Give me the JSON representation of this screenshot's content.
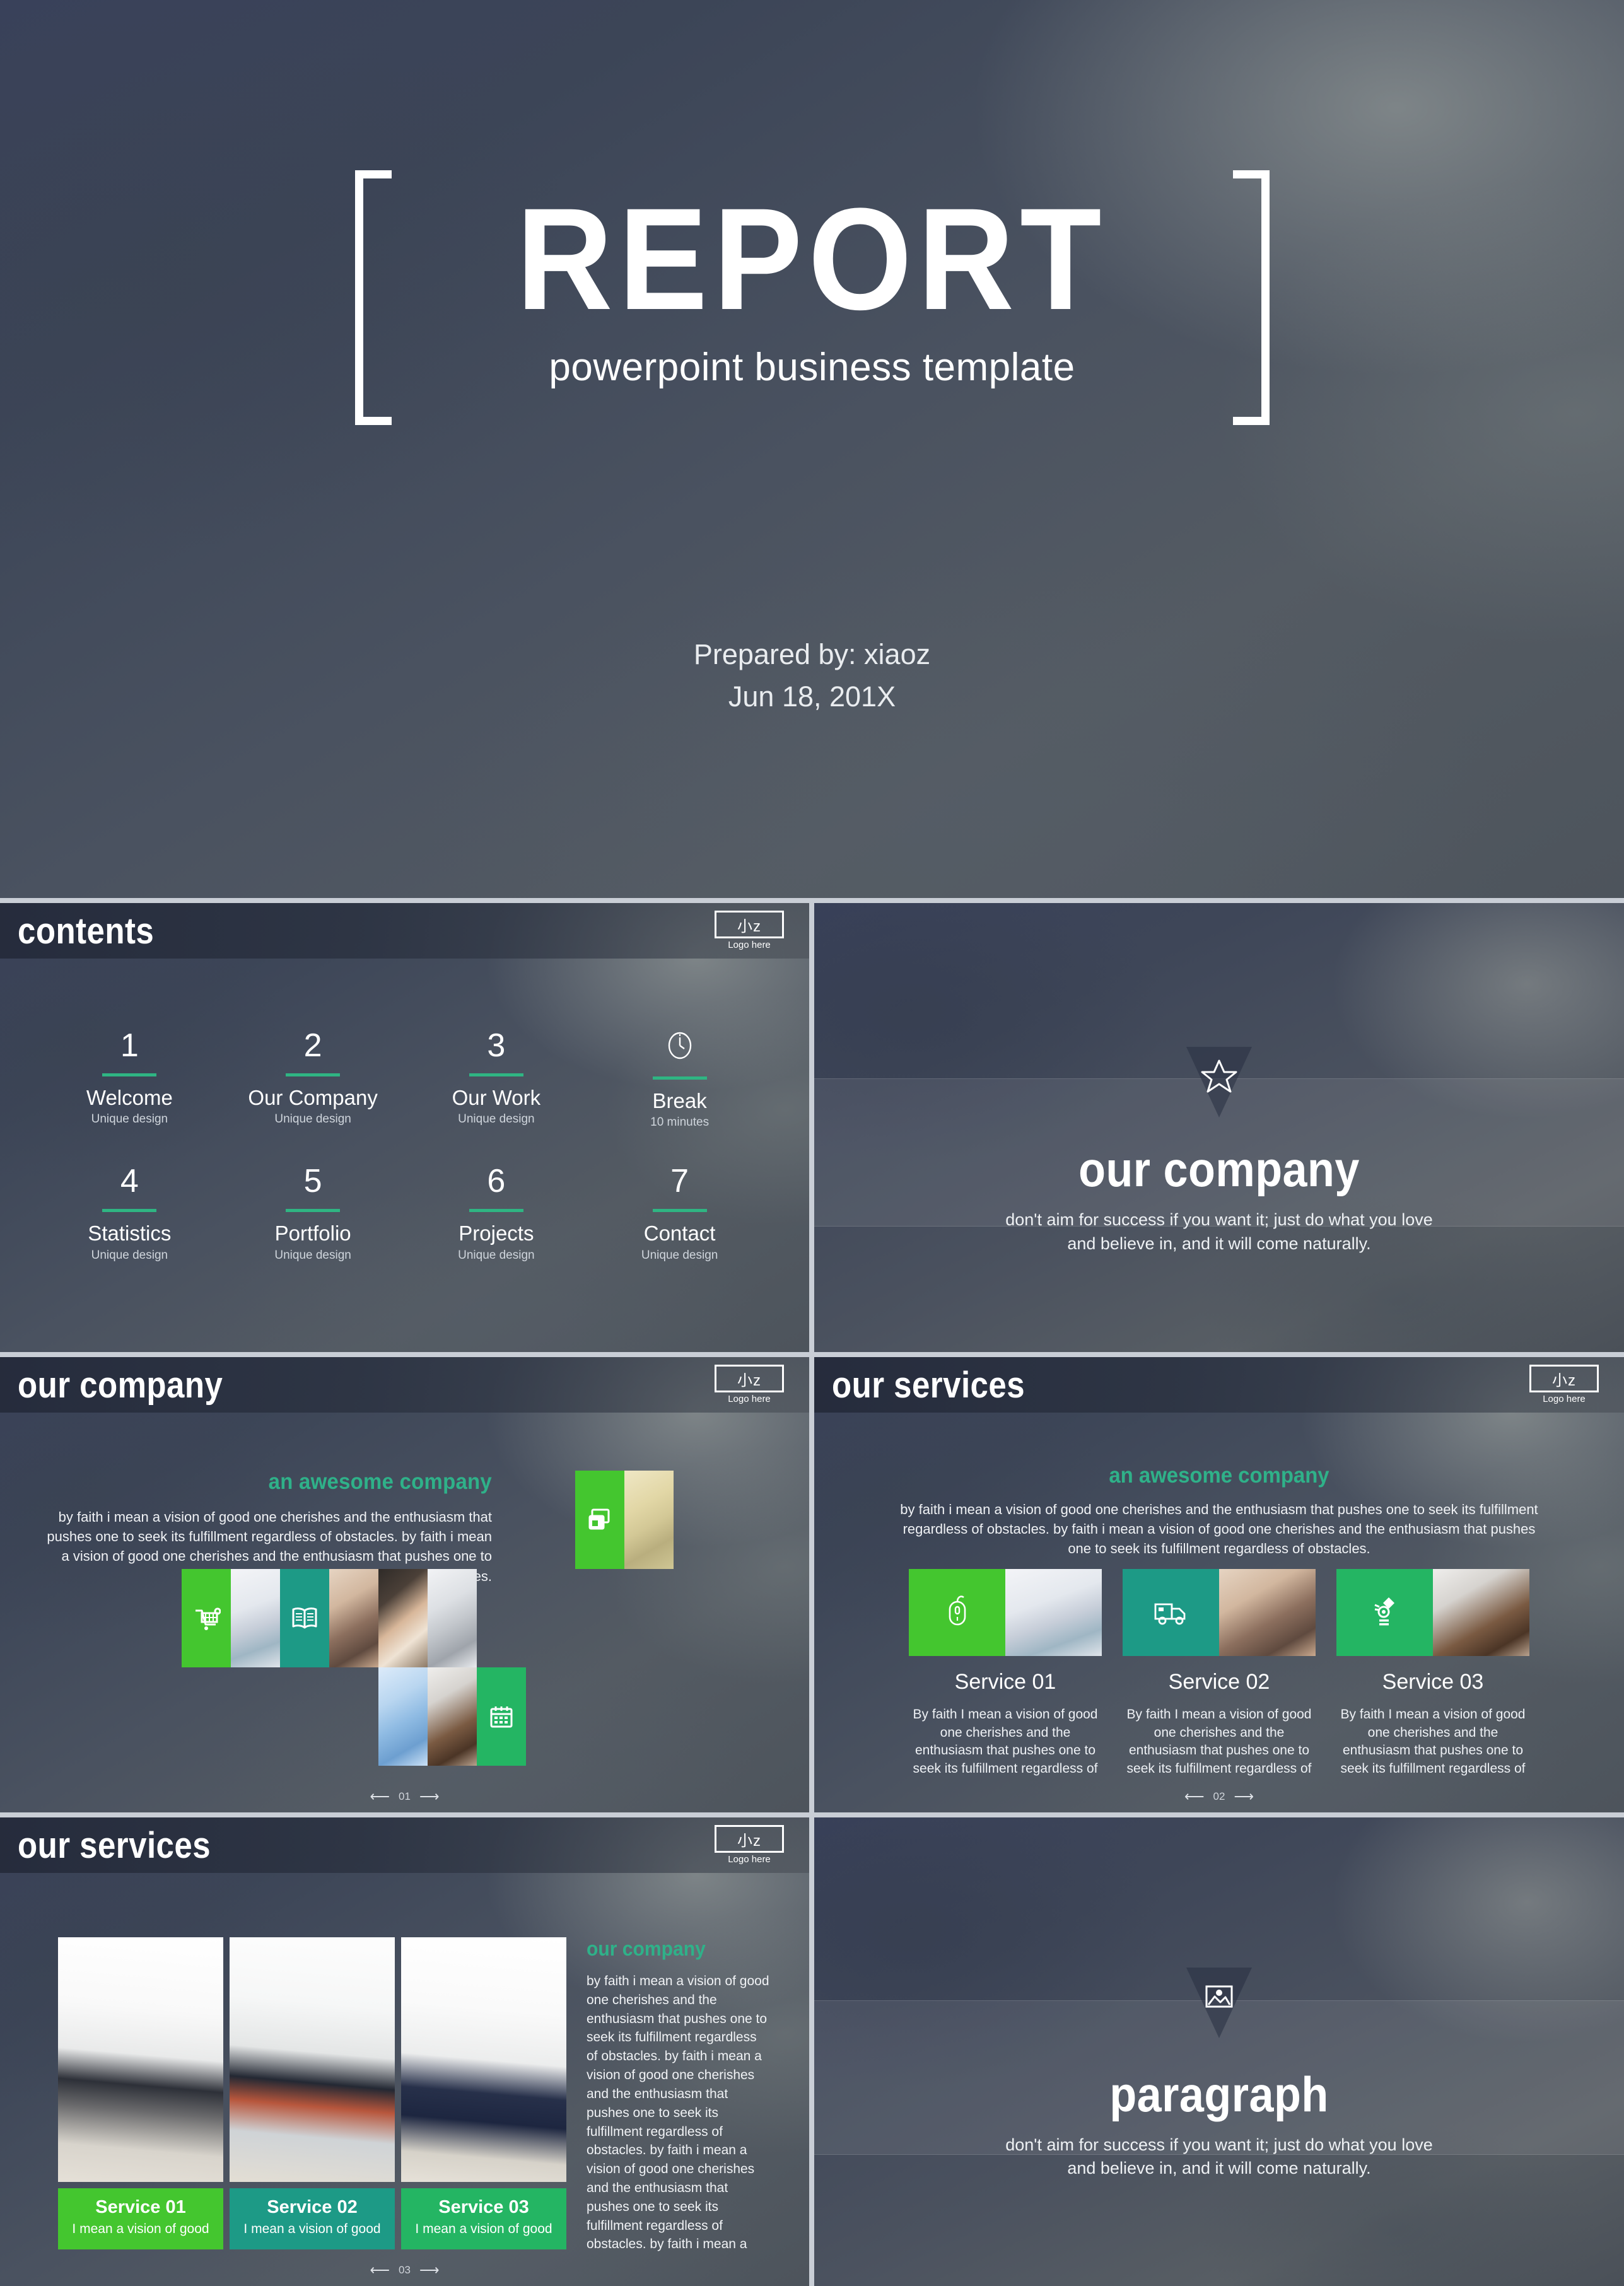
{
  "cover": {
    "title": "REPORT",
    "subtitle": "powerpoint business template",
    "prepared_by": "Prepared by: xiaoz",
    "date": "Jun 18, 201X"
  },
  "brand": {
    "logo_mark": "小z",
    "logo_caption": "Logo here",
    "accent_green": "#2fb189",
    "tile_green": "#44c62f",
    "tile_teal": "#1d9a86",
    "tile_emerald": "#24b563",
    "rule_green": "#2fb583"
  },
  "contents": {
    "header_title": "contents",
    "items": [
      {
        "num": "1",
        "label": "Welcome",
        "note": "Unique design",
        "icon": ""
      },
      {
        "num": "2",
        "label": "Our Company",
        "note": "Unique design",
        "icon": ""
      },
      {
        "num": "3",
        "label": "Our Work",
        "note": "Unique design",
        "icon": ""
      },
      {
        "num": "",
        "label": "Break",
        "note": "10 minutes",
        "icon": "clock-icon"
      },
      {
        "num": "4",
        "label": "Statistics",
        "note": "Unique design",
        "icon": ""
      },
      {
        "num": "5",
        "label": "Portfolio",
        "note": "Unique design",
        "icon": ""
      },
      {
        "num": "6",
        "label": "Projects",
        "note": "Unique design",
        "icon": ""
      },
      {
        "num": "7",
        "label": "Contact",
        "note": "Unique design",
        "icon": ""
      }
    ]
  },
  "section_company": {
    "icon": "star-icon",
    "title": "our company",
    "quote_line1": "don't aim for success if you want it; just do what you love",
    "quote_line2": "and believe in, and it will come naturally."
  },
  "section_paragraph": {
    "icon": "image-icon",
    "title": "paragraph",
    "quote_line1": "don't aim for success if you want it; just do what you love",
    "quote_line2": "and believe in, and it will come naturally."
  },
  "company": {
    "header_title": "our company",
    "heading": "an awesome company",
    "body": "by faith i mean a vision of good one cherishes and the enthusiasm that pushes one to seek its fulfillment regardless of obstacles. by faith i mean a vision of good one cherishes and the enthusiasm that pushes one to seek its fulfillment regardless of obstacles.",
    "page": "01",
    "prev_arrow": "⟵",
    "next_arrow": "⟶",
    "tiles": [
      {
        "kind": "icon",
        "icon": "cards-icon",
        "color": "tile-green"
      },
      {
        "kind": "photo",
        "photo": "ph-notebook"
      },
      {
        "kind": "icon",
        "icon": "cart-icon",
        "color": "tile-green"
      },
      {
        "kind": "photo",
        "photo": "ph-plane"
      },
      {
        "kind": "icon",
        "icon": "book-icon",
        "color": "tile-teal"
      },
      {
        "kind": "photo",
        "photo": "ph-desk"
      },
      {
        "kind": "photo",
        "photo": "ph-hand"
      },
      {
        "kind": "photo",
        "photo": "ph-keyboard"
      },
      {
        "kind": "photo",
        "photo": "ph-glasses"
      },
      {
        "kind": "photo",
        "photo": "ph-fax"
      },
      {
        "kind": "icon",
        "icon": "calendar-icon",
        "color": "tile-emerald"
      }
    ]
  },
  "services_cards": {
    "header_title": "our services",
    "heading": "an awesome company",
    "body": "by faith i mean a vision of good one cherishes and the enthusiasm that pushes one to seek its fulfillment regardless of obstacles. by faith i mean a vision of good one cherishes and the enthusiasm that pushes one to seek its fulfillment regardless of obstacles.",
    "page": "02",
    "prev_arrow": "⟵",
    "next_arrow": "⟶",
    "cards": [
      {
        "icon": "mouse-icon",
        "color": "tile-green",
        "photo": "ph-plane",
        "title": "Service 01",
        "text": "By faith I mean a vision of good one cherishes and the enthusiasm that pushes one to seek its fulfillment regardless of"
      },
      {
        "icon": "truck-icon",
        "color": "tile-teal",
        "photo": "ph-desk",
        "title": "Service 02",
        "text": "By faith I mean a vision of good one cherishes and the enthusiasm that pushes one to seek its fulfillment regardless of"
      },
      {
        "icon": "bulb-icon",
        "color": "tile-emerald",
        "photo": "ph-fax",
        "title": "Service 03",
        "text": "By faith I mean a vision of good one cherishes and the enthusiasm that pushes one to seek its fulfillment regardless of"
      }
    ]
  },
  "services_rooms": {
    "header_title": "our services",
    "heading": "our company",
    "body": "by faith i mean a vision of good one cherishes and the enthusiasm that pushes one to seek its fulfillment regardless of obstacles. by faith i mean a vision of good one cherishes and the enthusiasm that pushes one to seek its fulfillment regardless of obstacles. by faith i mean a vision of good one cherishes and the enthusiasm that pushes one to seek its fulfillment regardless of obstacles. by faith i mean a",
    "page": "03",
    "prev_arrow": "⟵",
    "next_arrow": "⟶",
    "cards": [
      {
        "photo": "p1",
        "color": "tile-green",
        "title": "Service 01",
        "note": "I mean a vision of good"
      },
      {
        "photo": "p2",
        "color": "tile-teal",
        "title": "Service 02",
        "note": "I mean a vision of good"
      },
      {
        "photo": "p3",
        "color": "tile-emerald",
        "title": "Service 03",
        "note": "I mean a vision of good"
      }
    ]
  }
}
